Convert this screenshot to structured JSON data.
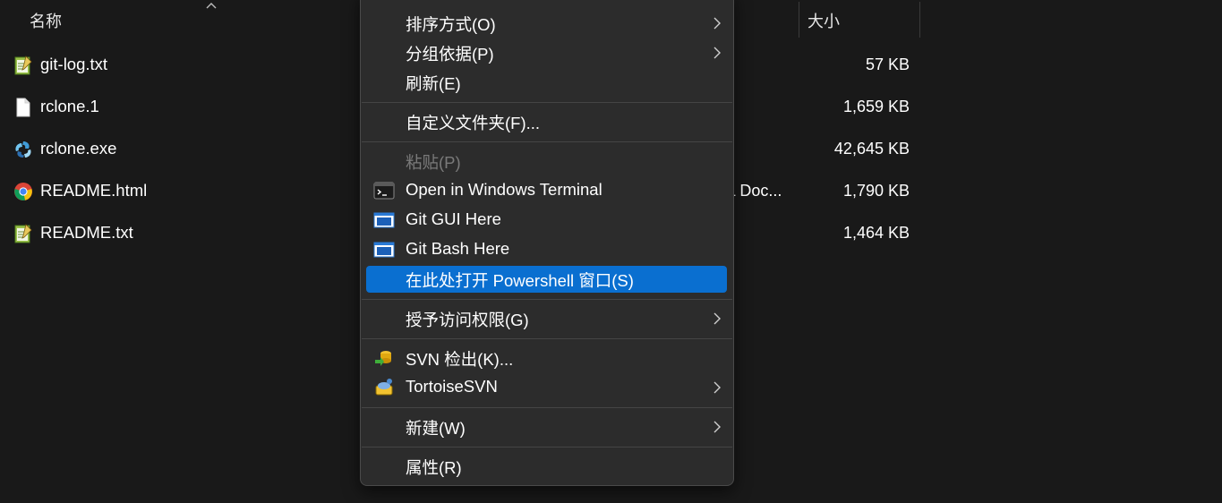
{
  "columns": {
    "name_label": "名称",
    "size_label": "大小"
  },
  "files": [
    {
      "name": "git-log.txt",
      "size": "57 KB",
      "icon": "notepad-text-file-icon"
    },
    {
      "name": "rclone.1",
      "size": "1,659 KB",
      "icon": "blank-file-icon"
    },
    {
      "name": "rclone.exe",
      "size": "42,645 KB",
      "icon": "rclone-app-icon"
    },
    {
      "name": "README.html",
      "size": "1,790 KB",
      "icon": "chrome-icon",
      "type_partial": "L Doc..."
    },
    {
      "name": "README.txt",
      "size": "1,464 KB",
      "icon": "notepad-text-file-icon"
    }
  ],
  "context_menu": {
    "items": [
      {
        "label": "排序方式(O)",
        "submenu": true
      },
      {
        "label": "分组依据(P)",
        "submenu": true
      },
      {
        "label": "刷新(E)",
        "submenu": false
      },
      {
        "label": "自定义文件夹(F)...",
        "submenu": false
      },
      {
        "label": "粘贴(P)",
        "submenu": false,
        "disabled": true
      },
      {
        "label": "Open in Windows Terminal",
        "submenu": false,
        "icon": "terminal-icon"
      },
      {
        "label": "Git GUI Here",
        "submenu": false,
        "icon": "git-gui-icon"
      },
      {
        "label": "Git Bash Here",
        "submenu": false,
        "icon": "git-bash-icon"
      },
      {
        "label": "在此处打开 Powershell 窗口(S)",
        "submenu": false,
        "highlighted": true
      },
      {
        "label": "授予访问权限(G)",
        "submenu": true
      },
      {
        "label": "SVN 检出(K)...",
        "submenu": false,
        "icon": "svn-checkout-icon"
      },
      {
        "label": "TortoiseSVN",
        "submenu": true,
        "icon": "tortoisesvn-icon"
      },
      {
        "label": "新建(W)",
        "submenu": true
      },
      {
        "label": "属性(R)",
        "submenu": false
      }
    ]
  },
  "colors": {
    "background": "#191919",
    "menu_background": "#2c2c2c",
    "highlight": "#0a6fd0",
    "disabled_text": "#7a7a7a"
  }
}
